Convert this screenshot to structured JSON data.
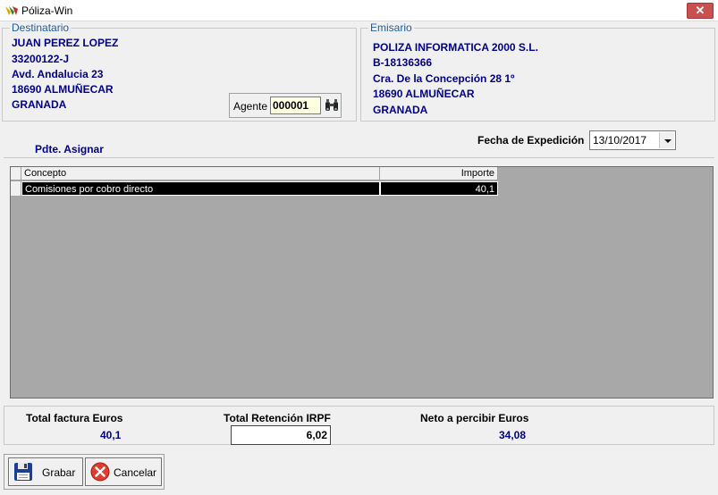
{
  "window": {
    "title": "Póliza-Win",
    "close_label": "✕"
  },
  "destinatario": {
    "legend": "Destinatario",
    "lines": [
      "JUAN PEREZ LOPEZ",
      "33200122-J",
      "Avd. Andalucia 23",
      "18690 ALMUÑECAR",
      "GRANADA"
    ],
    "agente_label": "Agente :",
    "agente_value": "000001"
  },
  "emisario": {
    "legend": "Emisario",
    "lines": [
      "POLIZA INFORMATICA 2000 S.L.",
      "B-18136366",
      "Cra. De la Concepción 28 1º",
      "18690  ALMUÑECAR",
      "GRANADA"
    ]
  },
  "status_text": "Pdte. Asignar",
  "fecha": {
    "label": "Fecha de Expedición",
    "value": "13/10/2017"
  },
  "grid": {
    "columns": [
      "Concepto",
      "Importe"
    ],
    "rows": [
      {
        "concepto": "Comisiones por cobro directo",
        "importe": "40,1"
      }
    ]
  },
  "totals": {
    "total_factura_label": "Total factura Euros",
    "total_factura_value": "40,1",
    "retencion_label": "Total Retención IRPF",
    "retencion_value": "6,02",
    "neto_label": "Neto a percibir Euros",
    "neto_value": "34,08"
  },
  "buttons": {
    "grabar": "Grabar",
    "cancelar": "Cancelar"
  },
  "icons": {
    "app": "poliza-app-icon",
    "search": "binoculars-icon",
    "save": "floppy-disk-icon",
    "cancel": "cancel-x-icon"
  },
  "colors": {
    "legend": "#1e5ea8",
    "address": "#00008b",
    "selection": "#000000",
    "grid_bg": "#a8a8a8",
    "close": "#c75050"
  }
}
